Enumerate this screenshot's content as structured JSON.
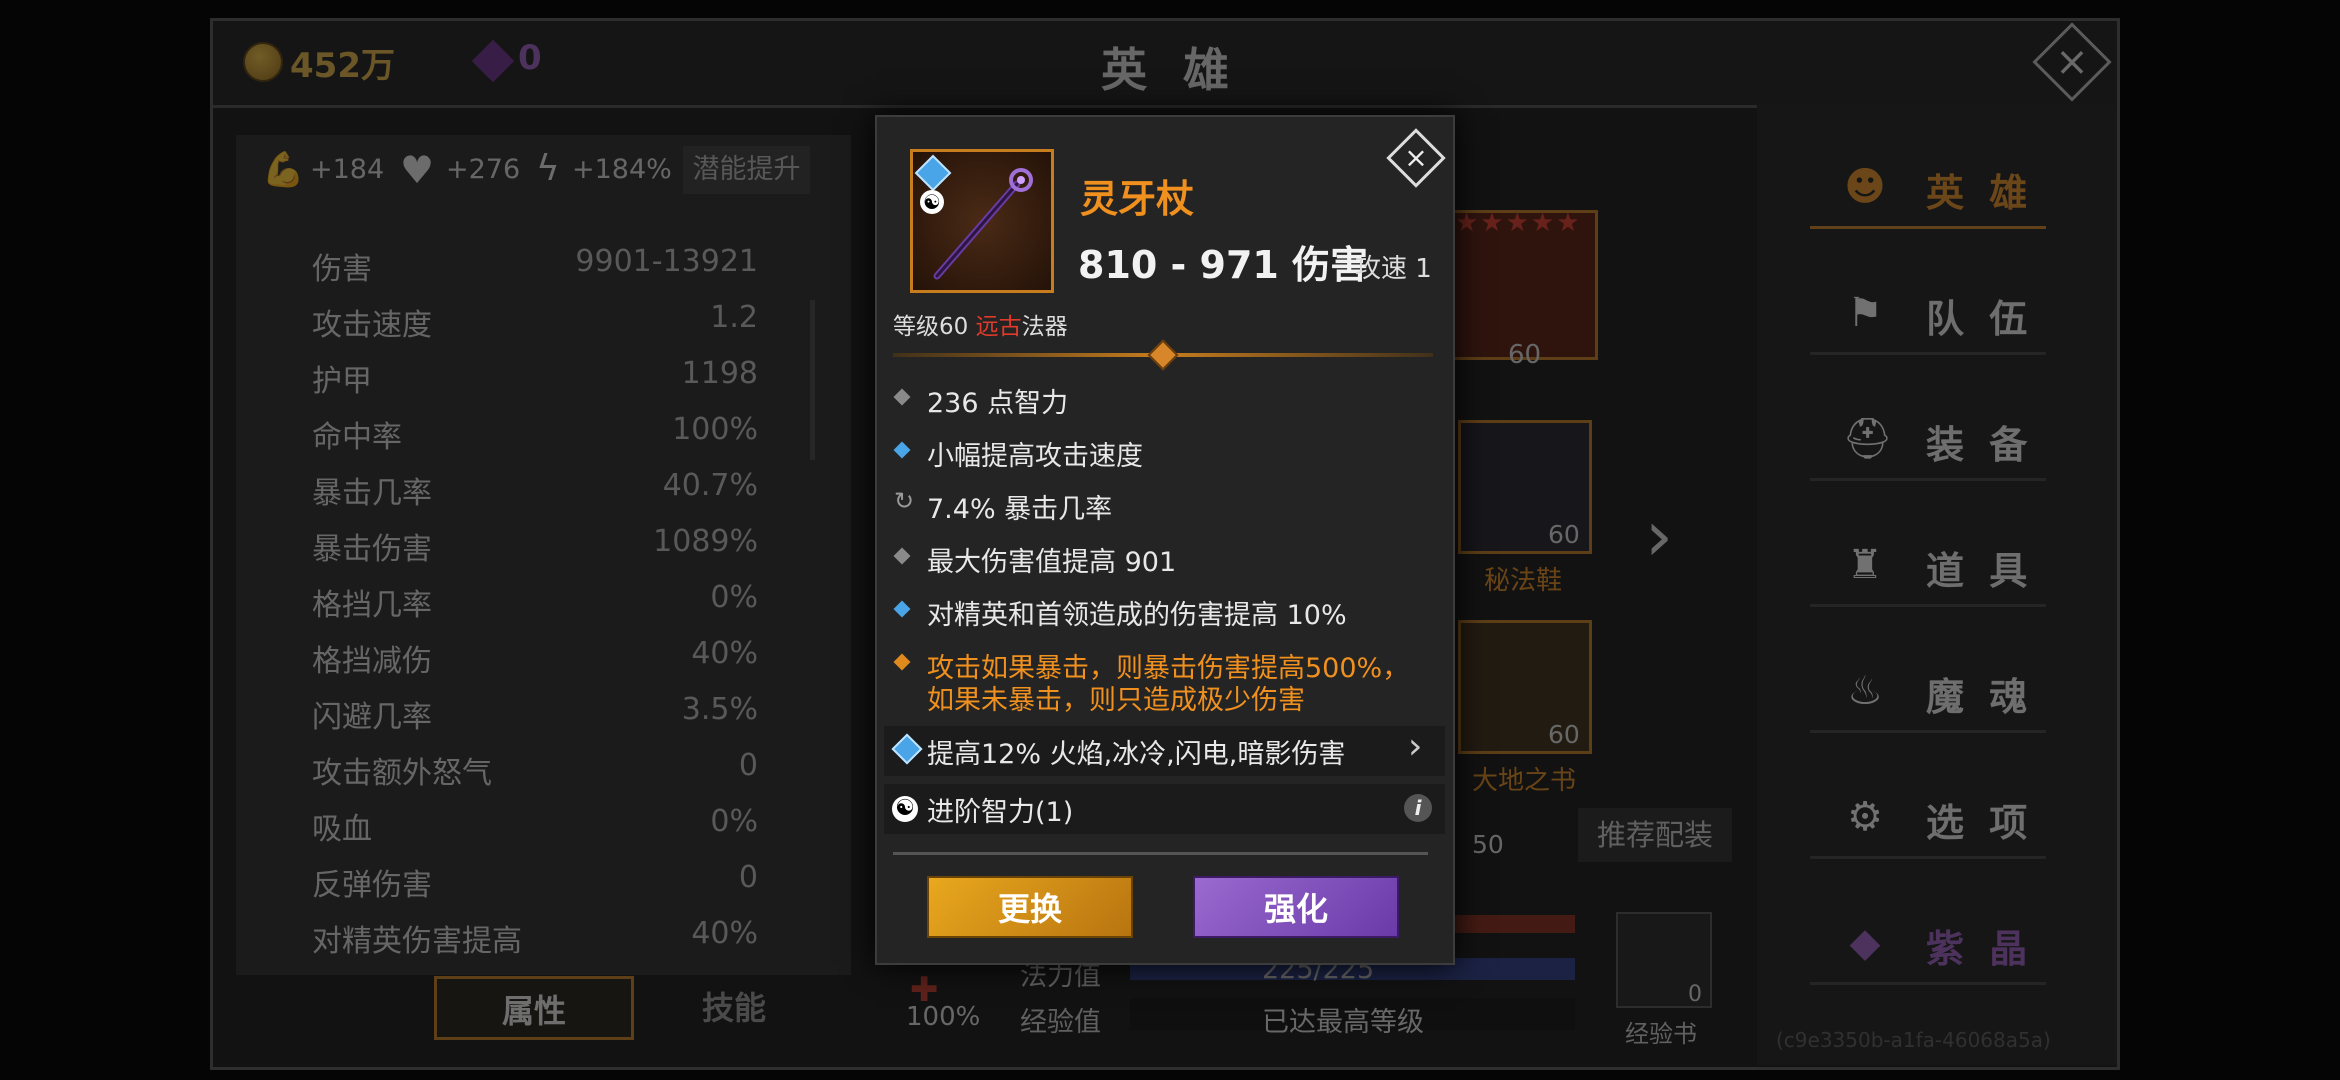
{
  "top_bar": {
    "gold": "452万",
    "gems": "0",
    "title": "英 雄"
  },
  "left_panel": {
    "potentials": [
      "+184",
      "+276",
      "+184%"
    ],
    "potential_button": "潜能提升",
    "stats": [
      {
        "label": "伤害",
        "value": "9901-13921"
      },
      {
        "label": "攻击速度",
        "value": "1.2"
      },
      {
        "label": "护甲",
        "value": "1198"
      },
      {
        "label": "命中率",
        "value": "100%"
      },
      {
        "label": "暴击几率",
        "value": "40.7%"
      },
      {
        "label": "暴击伤害",
        "value": "1089%"
      },
      {
        "label": "格挡几率",
        "value": "0%"
      },
      {
        "label": "格挡减伤",
        "value": "40%"
      },
      {
        "label": "闪避几率",
        "value": "3.5%"
      },
      {
        "label": "攻击额外怒气",
        "value": "0"
      },
      {
        "label": "吸血",
        "value": "0%"
      },
      {
        "label": "反弹伤害",
        "value": "0"
      },
      {
        "label": "对精英伤害提高",
        "value": "40%"
      }
    ],
    "tabs": [
      "属性",
      "技能"
    ]
  },
  "middle": {
    "hero_level": "60",
    "boots_level": "60",
    "boots_name": "秘法鞋",
    "book_level": "60",
    "book_name": "大地之书",
    "partial_level": "50",
    "recommend_button": "推荐配装",
    "mana_label": "法力值",
    "mana_value": "225/225",
    "exp_label": "经验值",
    "exp_value": "已达最高等级",
    "percent": "100%",
    "exp_book_label": "经验书",
    "exp_book_count": "0"
  },
  "side_nav": [
    "英 雄",
    "队 伍",
    "装 备",
    "道 具",
    "魔 魂",
    "选 项",
    "紫 晶"
  ],
  "footer_id": "(c9e3350b-a1fa-46068a5a)",
  "popup": {
    "item_name": "灵牙杖",
    "damage_text": "810 - 971 伤害",
    "speed_text": "攻速 1",
    "level_prefix": "等级60 ",
    "level_range": "远古",
    "level_suffix": "法器",
    "attributes": [
      "236 点智力",
      "小幅提高攻击速度",
      "7.4% 暴击几率",
      "最大伤害值提高 901",
      "对精英和首领造成的伤害提高 10%"
    ],
    "legendary_line1": "攻击如果暴击，则暴击伤害提高500%，",
    "legendary_line2": "如果未暴击，则只造成极少伤害",
    "socket_gem": "提高12% 火焰,冰冷,闪电,暗影伤害",
    "socket_yin": "进阶智力(1)",
    "btn_change": "更换",
    "btn_upgrade": "强化"
  },
  "colors": {
    "accent_orange": "#f0901e",
    "ancient_red": "#e03a2a",
    "gold_button": "#e9a81e",
    "purple_button": "#8a5ac8"
  }
}
